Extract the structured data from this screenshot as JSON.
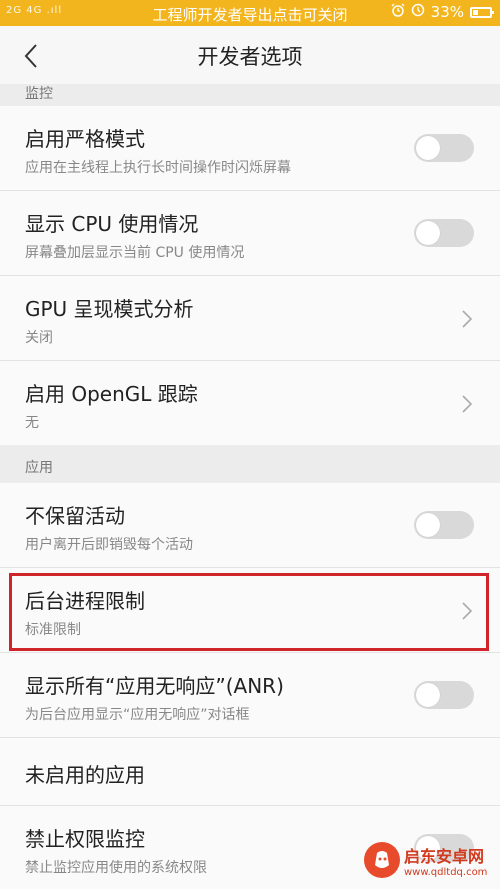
{
  "status_bar": {
    "signal": "2G 4G .ıll",
    "notice": "工程师开发者导出点击可关闭",
    "icons": [
      "alarm-icon",
      "clock-icon"
    ],
    "battery": "33%",
    "battery_level": 0.33,
    "color": "#f3b51d"
  },
  "header": {
    "title": "开发者选项",
    "back_icon": "chevron-left-icon"
  },
  "sections": [
    {
      "label": "监控"
    },
    {
      "label": "应用"
    }
  ],
  "rows": [
    {
      "title": "启用严格模式",
      "subtitle": "应用在主线程上执行长时间操作时闪烁屏幕",
      "control": "toggle",
      "on": false
    },
    {
      "title": "显示 CPU 使用情况",
      "subtitle": "屏幕叠加层显示当前 CPU 使用情况",
      "control": "toggle",
      "on": false
    },
    {
      "title": "GPU 呈现模式分析",
      "subtitle": "关闭",
      "control": "chevron"
    },
    {
      "title": "启用 OpenGL 跟踪",
      "subtitle": "无",
      "control": "chevron"
    },
    {
      "title": "不保留活动",
      "subtitle": "用户离开后即销毁每个活动",
      "control": "toggle",
      "on": false
    },
    {
      "title": "后台进程限制",
      "subtitle": "标准限制",
      "control": "chevron",
      "highlighted": true
    },
    {
      "title": "显示所有“应用无响应”(ANR)",
      "subtitle": "为后台应用显示“应用无响应”对话框",
      "control": "toggle",
      "on": false
    },
    {
      "title": "未启用的应用",
      "subtitle": "",
      "control": "none"
    },
    {
      "title": "禁止权限监控",
      "subtitle": "禁止监控应用使用的系统权限",
      "control": "toggle",
      "on": false
    }
  ],
  "highlight_color": "#d0242b",
  "watermark": {
    "name": "启东安卓网",
    "url": "www.qdltdq.com"
  }
}
